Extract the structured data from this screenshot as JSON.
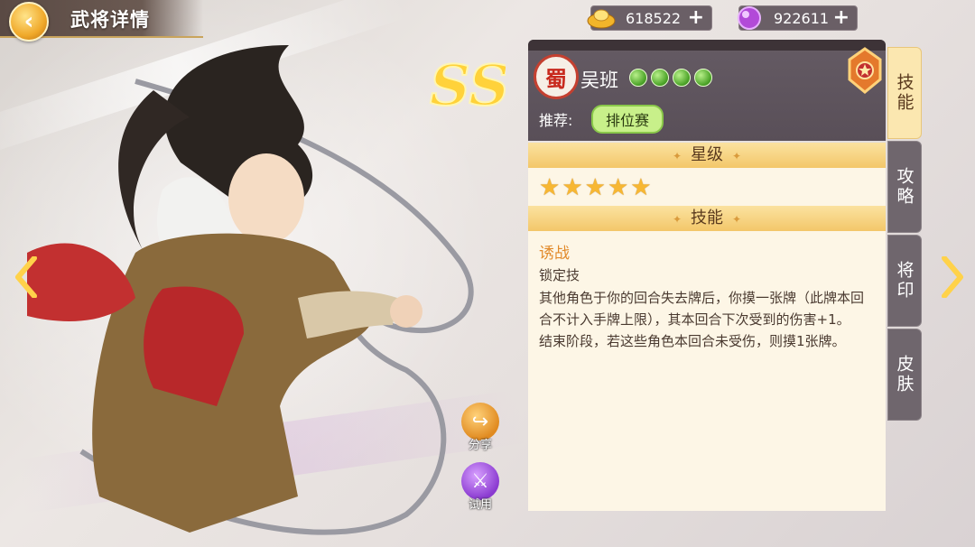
{
  "header": {
    "title": "武将详情",
    "back_icon": "back-arrow-icon"
  },
  "currencies": [
    {
      "name": "gold",
      "icon": "gold-ingot-icon",
      "value": "618522",
      "plus": "+"
    },
    {
      "name": "gem",
      "icon": "purple-orb-icon",
      "value": "922611",
      "plus": "+"
    }
  ],
  "rarity": "SS",
  "character": {
    "faction": "蜀",
    "name": "吴班",
    "gem_count": 4,
    "recommend_label": "推荐:",
    "recommend_tag": "排位赛"
  },
  "sections": {
    "stars_title": "星级",
    "star_count": 5,
    "skills_title": "技能"
  },
  "skill": {
    "name": "诱战",
    "type": "锁定技",
    "desc1": "其他角色于你的回合失去牌后，你摸一张牌（此牌本回合不计入手牌上限），其本回合下次受到的伤害+1。",
    "desc2": "结束阶段，若这些角色本回合未受伤，则摸1张牌。"
  },
  "tabs": [
    {
      "label": "技能",
      "active": true
    },
    {
      "label": "攻略",
      "active": false
    },
    {
      "label": "将印",
      "active": false
    },
    {
      "label": "皮肤",
      "active": false
    }
  ],
  "actions": {
    "share": "分享",
    "trial": "试用"
  },
  "colors": {
    "accent": "#f3c769",
    "panel_bg": "#fdf6e6",
    "header_bg": "#5f555e",
    "skill_name": "#e28a2a"
  }
}
